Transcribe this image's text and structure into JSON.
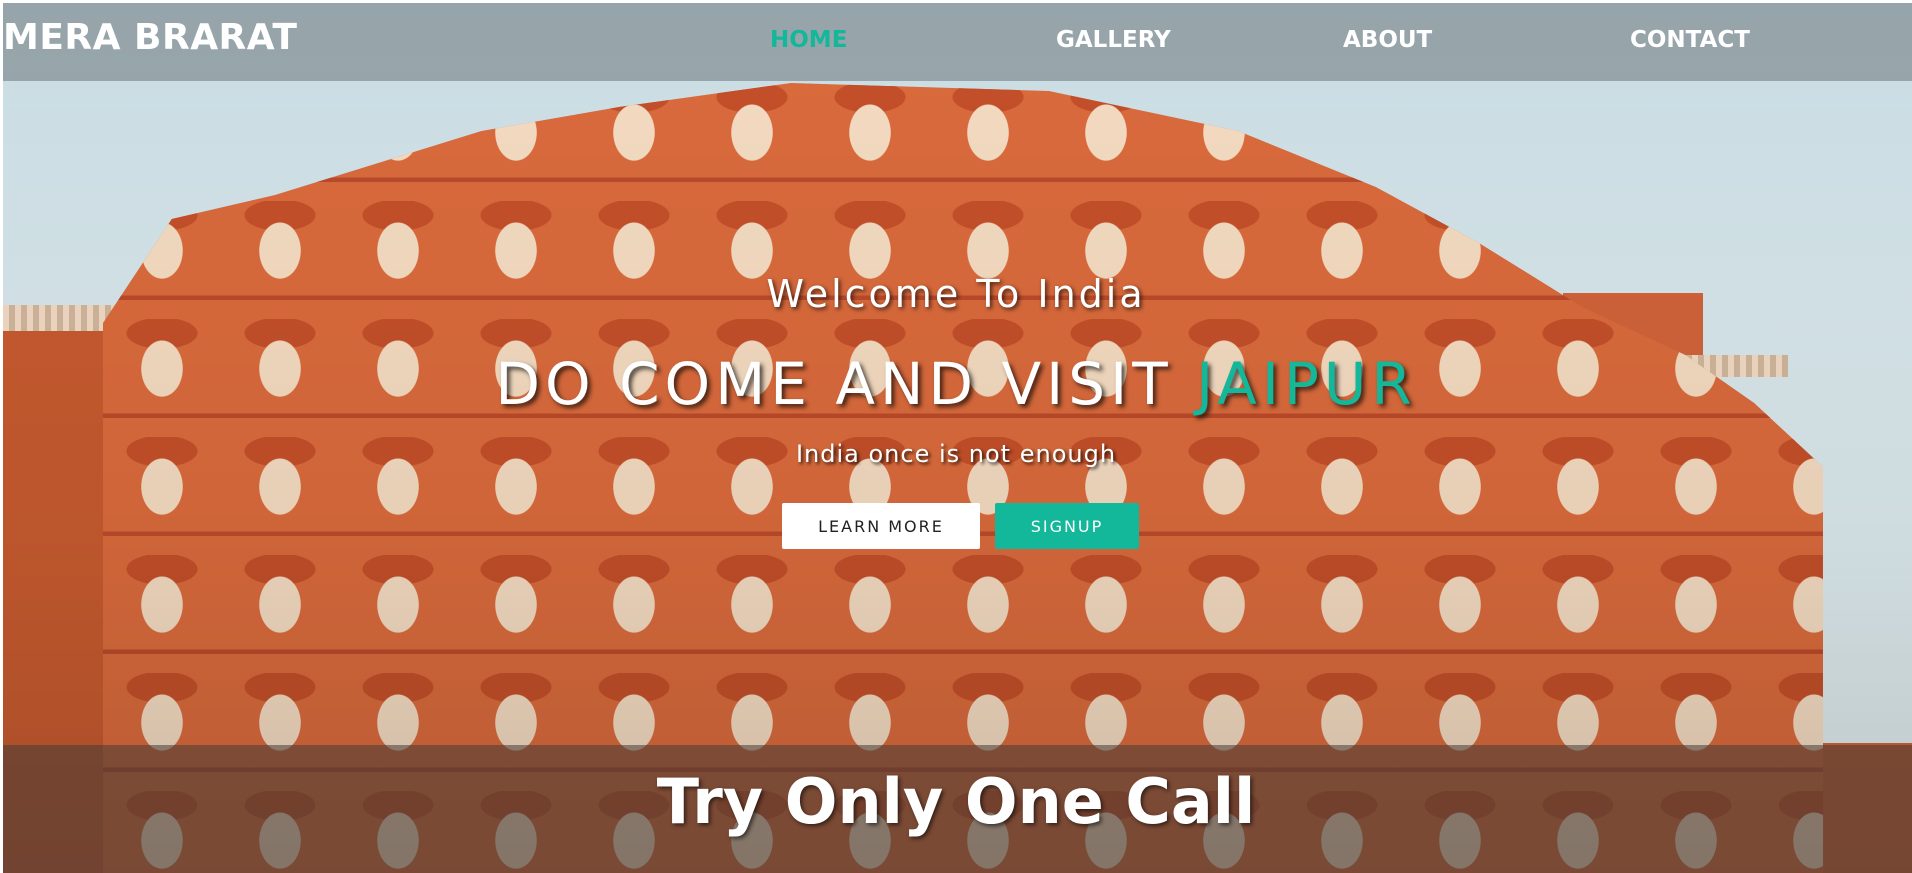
{
  "brand": "MERA BRARAT",
  "nav": {
    "home": "HOME",
    "gallery": "GALLERY",
    "about": "ABOUT",
    "contact": "CONTACT",
    "active": "home"
  },
  "hero": {
    "welcome": "Welcome To India",
    "headline_main": "DO COME AND VISIT ",
    "headline_accent": "JAIPUR",
    "tagline": "India once is not enough",
    "learn_more_label": "LEARN MORE",
    "signup_label": "SIGNUP"
  },
  "bottom": {
    "title": "Try Only One Call"
  },
  "colors": {
    "accent": "#13b799",
    "facade": "#d96a3c"
  }
}
